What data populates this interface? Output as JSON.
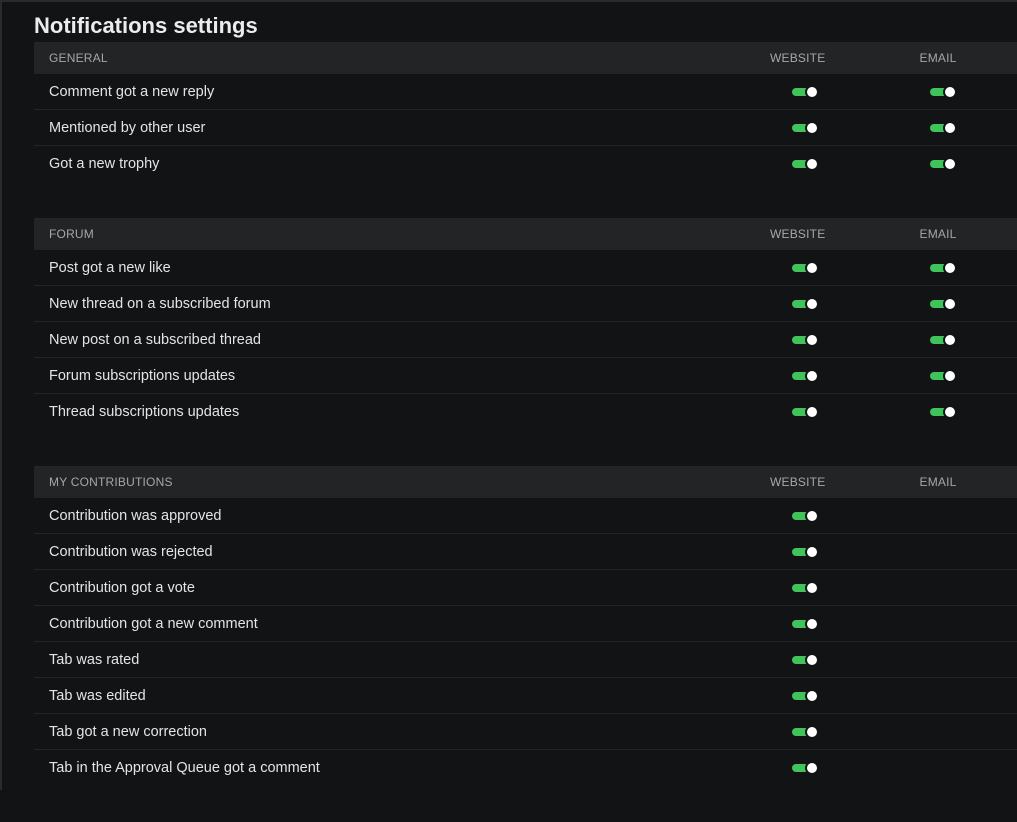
{
  "page": {
    "title": "Notifications settings"
  },
  "colors": {
    "background": "#121314",
    "header_bg": "#232425",
    "toggle_on": "#3fc35a"
  },
  "sections": [
    {
      "name": "GENERAL",
      "website_label": "WEBSITE",
      "email_label": "EMAIL",
      "rows": [
        {
          "label": "Comment got a new reply",
          "website": true,
          "email": true
        },
        {
          "label": "Mentioned by other user",
          "website": true,
          "email": true
        },
        {
          "label": "Got a new trophy",
          "website": true,
          "email": true
        }
      ]
    },
    {
      "name": "FORUM",
      "website_label": "WEBSITE",
      "email_label": "EMAIL",
      "rows": [
        {
          "label": "Post got a new like",
          "website": true,
          "email": true
        },
        {
          "label": "New thread on a subscribed forum",
          "website": true,
          "email": true
        },
        {
          "label": "New post on a subscribed thread",
          "website": true,
          "email": true
        },
        {
          "label": "Forum subscriptions updates",
          "website": true,
          "email": true
        },
        {
          "label": "Thread subscriptions updates",
          "website": true,
          "email": true
        }
      ]
    },
    {
      "name": "MY CONTRIBUTIONS",
      "website_label": "WEBSITE",
      "email_label": "EMAIL",
      "rows": [
        {
          "label": "Contribution was approved",
          "website": true,
          "email": null
        },
        {
          "label": "Contribution was rejected",
          "website": true,
          "email": null
        },
        {
          "label": "Contribution got a vote",
          "website": true,
          "email": null
        },
        {
          "label": "Contribution got a new comment",
          "website": true,
          "email": null
        },
        {
          "label": "Tab was rated",
          "website": true,
          "email": null
        },
        {
          "label": "Tab was edited",
          "website": true,
          "email": null
        },
        {
          "label": "Tab got a new correction",
          "website": true,
          "email": null
        },
        {
          "label": "Tab in the Approval Queue got a comment",
          "website": true,
          "email": null
        }
      ]
    }
  ]
}
